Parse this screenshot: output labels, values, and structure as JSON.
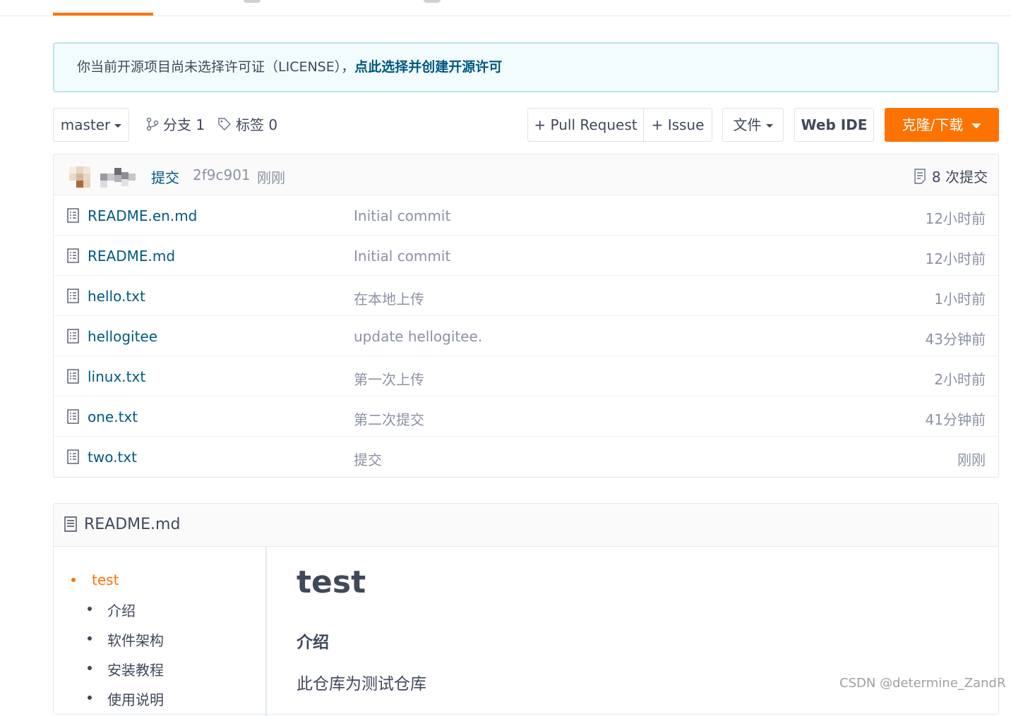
{
  "license_notice": {
    "text": "你当前开源项目尚未选择许可证（LICENSE），",
    "link": "点此选择并创建开源许可"
  },
  "toolbar": {
    "branch": "master",
    "branches_label": "分支 1",
    "tags_label": "标签 0",
    "pull_request": "+ Pull Request",
    "issue": "+ Issue",
    "file_menu": "文件",
    "web_ide": "Web IDE",
    "clone": "克隆/下载"
  },
  "commit": {
    "message": "提交",
    "hash": "2f9c901",
    "time": "刚刚",
    "count": "8 次提交"
  },
  "files": [
    {
      "name": "README.en.md",
      "message": "Initial commit",
      "time": "12小时前"
    },
    {
      "name": "README.md",
      "message": "Initial commit",
      "time": "12小时前"
    },
    {
      "name": "hello.txt",
      "message": "在本地上传",
      "time": "1小时前"
    },
    {
      "name": "hellogitee",
      "message": "update hellogitee.",
      "time": "43分钟前"
    },
    {
      "name": "linux.txt",
      "message": "第一次上传",
      "time": "2小时前"
    },
    {
      "name": "one.txt",
      "message": "第二次提交",
      "time": "41分钟前"
    },
    {
      "name": "two.txt",
      "message": "提交",
      "time": "刚刚"
    }
  ],
  "readme": {
    "title": "README.md",
    "toc": {
      "top": "test",
      "items": [
        "介绍",
        "软件架构",
        "安装教程",
        "使用说明"
      ]
    },
    "h1": "test",
    "h2": "介绍",
    "paragraph": "此仓库为测试仓库"
  },
  "watermark": "CSDN @determine_ZandR",
  "colors": {
    "accent": "#fe7300",
    "link": "#005980"
  }
}
